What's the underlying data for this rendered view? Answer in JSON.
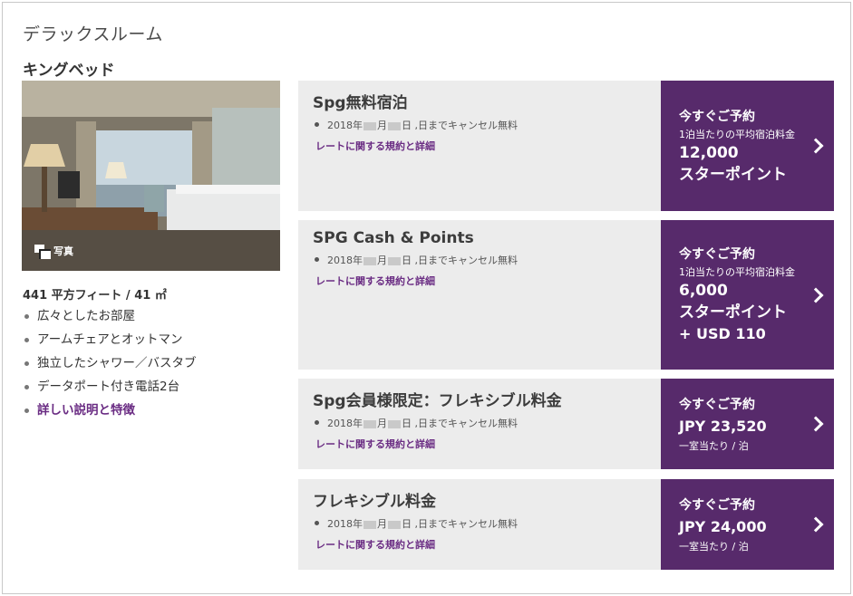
{
  "room": {
    "title": "デラックスルーム",
    "bed_type": "キングベッド",
    "photo_label": "写真",
    "size": "441 平方フィート / 41 ㎡",
    "features": [
      "広々としたお部屋",
      "アームチェアとオットマン",
      "独立したシャワー／バスタブ",
      "データポート付き電話2台"
    ],
    "details_link": "詳しい説明と特徴"
  },
  "rates": [
    {
      "name": "Spg無料宿泊",
      "cancel_prefix": "2018年",
      "cancel_month": "月",
      "cancel_suffix": "日 ,日までキャンセル無料",
      "rules_link": "レートに関する規約と詳細",
      "book_label": "今すぐご予約",
      "book_sub": "1泊当たりの平均宿泊料金",
      "price_line1": "12,000",
      "price_line2": "スターポイント",
      "price_line3": ""
    },
    {
      "name": "SPG Cash & Points",
      "cancel_prefix": "2018年",
      "cancel_month": "月",
      "cancel_suffix": "日 ,日までキャンセル無料",
      "rules_link": "レートに関する規約と詳細",
      "book_label": "今すぐご予約",
      "book_sub": "1泊当たりの平均宿泊料金",
      "price_line1": "6,000",
      "price_line2": "スターポイント",
      "price_line3": "+ USD 110"
    },
    {
      "name": "Spg会員様限定：フレキシブル料金",
      "cancel_prefix": "2018年",
      "cancel_month": "月",
      "cancel_suffix": "日 ,日までキャンセル無料",
      "rules_link": "レートに関する規約と詳細",
      "book_label": "今すぐご予約",
      "price": "JPY 23,520",
      "unit": "一室当たり / 泊"
    },
    {
      "name": "フレキシブル料金",
      "cancel_prefix": "2018年",
      "cancel_month": "月",
      "cancel_suffix": "日 ,日までキャンセル無料",
      "rules_link": "レートに関する規約と詳細",
      "book_label": "今すぐご予約",
      "price": "JPY 24,000",
      "unit": "一室当たり / 泊"
    }
  ],
  "colors": {
    "accent": "#572a6b",
    "link": "#6a2c83",
    "panel": "#ececec"
  },
  "icons": [
    "photo-gallery-icon",
    "chevron-right-icon"
  ]
}
